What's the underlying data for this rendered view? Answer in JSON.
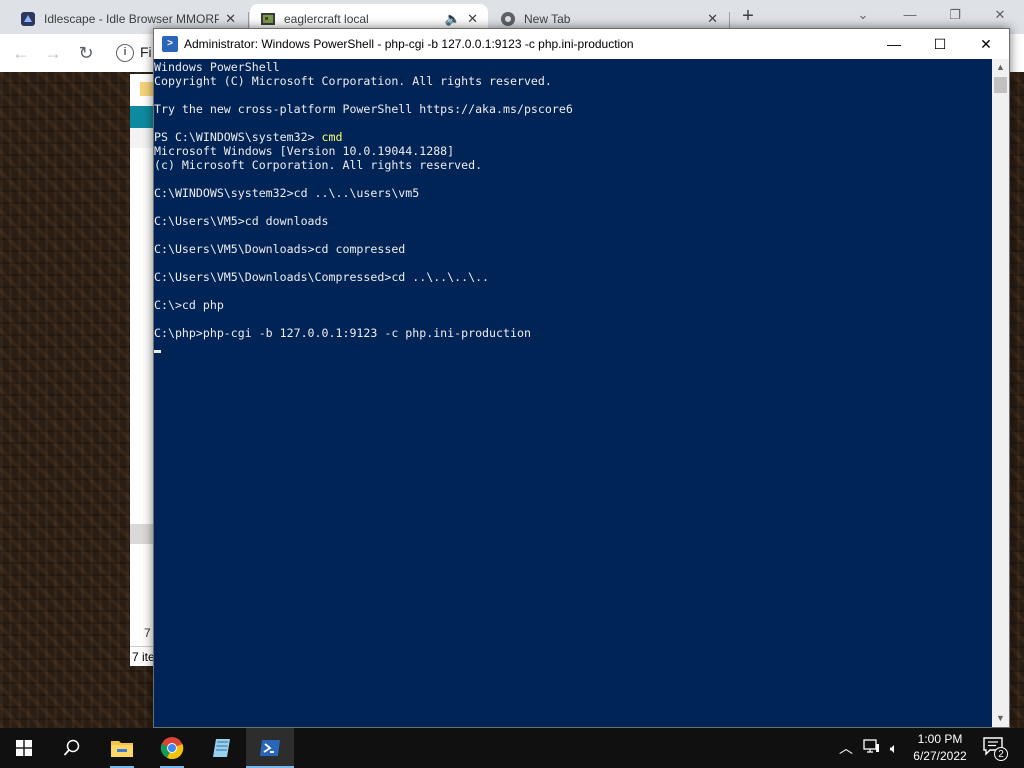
{
  "browser": {
    "tabs": [
      {
        "title": "Idlescape - Idle Browser MMORPG",
        "icon": "idlescape-favicon",
        "active": false
      },
      {
        "title": "eaglercraft local",
        "icon": "eaglercraft-favicon",
        "active": true,
        "audio": "speaker-icon"
      },
      {
        "title": "New Tab",
        "icon": "chrome-favicon",
        "active": false
      }
    ],
    "new_tab_symbol": "+",
    "address_text": "Fi"
  },
  "explorer": {
    "item_count_partial": "7",
    "status_partial": "7 ite"
  },
  "powershell": {
    "window_title": "Administrator: Windows PowerShell - php-cgi  -b 127.0.0.1:9123 -c php.ini-production",
    "lines": {
      "l1": "Windows PowerShell",
      "l2": "Copyright (C) Microsoft Corporation. All rights reserved.",
      "l3": "",
      "l4": "Try the new cross-platform PowerShell https://aka.ms/pscore6",
      "l5": "",
      "l6_prompt": "PS C:\\WINDOWS\\system32> ",
      "l6_cmd": "cmd",
      "l7": "Microsoft Windows [Version 10.0.19044.1288]",
      "l8": "(c) Microsoft Corporation. All rights reserved.",
      "l9": "",
      "l10": "C:\\WINDOWS\\system32>cd ..\\..\\users\\vm5",
      "l11": "",
      "l12": "C:\\Users\\VM5>cd downloads",
      "l13": "",
      "l14": "C:\\Users\\VM5\\Downloads>cd compressed",
      "l15": "",
      "l16": "C:\\Users\\VM5\\Downloads\\Compressed>cd ..\\..\\..\\..",
      "l17": "",
      "l18": "C:\\>cd php",
      "l19": "",
      "l20": "C:\\php>php-cgi -b 127.0.0.1:9123 -c php.ini-production",
      "l21": ""
    },
    "colors": {
      "background": "#012456",
      "text": "#eeedf0",
      "command": "#ffff66"
    }
  },
  "taskbar": {
    "apps": [
      {
        "name": "file-explorer-icon"
      },
      {
        "name": "chrome-icon"
      },
      {
        "name": "notepad-icon"
      },
      {
        "name": "powershell-icon"
      }
    ],
    "time": "1:00 PM",
    "date": "6/27/2022",
    "notifications": "2"
  }
}
